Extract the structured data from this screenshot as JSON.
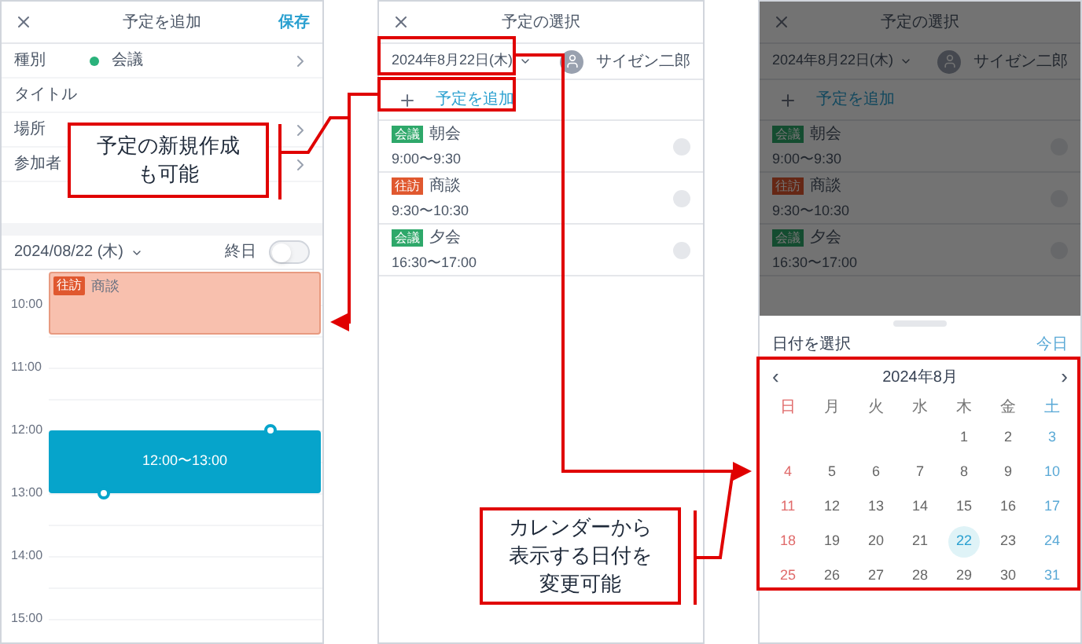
{
  "left_screen": {
    "title": "予定を追加",
    "save": "保存",
    "fields": [
      {
        "label": "種別",
        "value": "会議",
        "color": "#2ab27b",
        "chevron": true
      },
      {
        "label": "タイトル",
        "chevron": false
      },
      {
        "label": "場所",
        "chevron": true
      },
      {
        "label": "参加者",
        "chevron": true
      }
    ],
    "date": "2024/08/22 (木)",
    "all_day": {
      "label": "終日",
      "on": false
    },
    "hours": [
      "10:00",
      "11:00",
      "12:00",
      "13:00",
      "14:00",
      "15:00"
    ],
    "events": [
      {
        "kind": "visit",
        "tag": "往訪",
        "title": "商談"
      },
      {
        "kind": "draft",
        "time": "12:00〜13:00"
      }
    ]
  },
  "middle_screen": {
    "title": "予定の選択",
    "date": "2024年8月22日(木)",
    "user": "サイゼン二郎",
    "add": "予定を追加",
    "items": [
      {
        "kind": "meeting",
        "tag": "会議",
        "title": "朝会",
        "time": "9:00〜9:30",
        "selected": false
      },
      {
        "kind": "visit",
        "tag": "往訪",
        "title": "商談",
        "time": "9:30〜10:30",
        "selected": false
      },
      {
        "kind": "meeting",
        "tag": "会議",
        "title": "夕会",
        "time": "16:30〜17:00",
        "selected": false
      }
    ]
  },
  "right_screen": {
    "title": "予定の選択",
    "date": "2024年8月22日(木)",
    "user": "サイゼン二郎",
    "add": "予定を追加",
    "items": [
      {
        "kind": "meeting",
        "tag": "会議",
        "title": "朝会",
        "time": "9:00〜9:30",
        "selected": false
      },
      {
        "kind": "visit",
        "tag": "往訪",
        "title": "商談",
        "time": "9:30〜10:30",
        "selected": false
      },
      {
        "kind": "meeting",
        "tag": "会議",
        "title": "夕会",
        "time": "16:30〜17:00",
        "selected": false
      }
    ],
    "picker": {
      "title": "日付を選択",
      "today": "今日",
      "month": "2024年8月",
      "prev": "‹",
      "next": "›",
      "weekdays": [
        {
          "label": "日",
          "color": "#e06a6a"
        },
        {
          "label": "月",
          "color": "#777777"
        },
        {
          "label": "火",
          "color": "#777777"
        },
        {
          "label": "水",
          "color": "#777777"
        },
        {
          "label": "木",
          "color": "#777777"
        },
        {
          "label": "金",
          "color": "#777777"
        },
        {
          "label": "土",
          "color": "#5aa9d6"
        }
      ],
      "weeks": [
        [
          {
            "day": "1",
            "selected": false
          },
          {
            "day": "2",
            "selected": false
          },
          {
            "day": "3",
            "selected": false
          }
        ],
        [
          {
            "day": "4",
            "selected": false
          },
          {
            "day": "5",
            "selected": false
          },
          {
            "day": "6",
            "selected": false
          },
          {
            "day": "7",
            "selected": false
          },
          {
            "day": "8",
            "selected": false
          },
          {
            "day": "9",
            "selected": false
          },
          {
            "day": "10",
            "selected": false
          }
        ],
        [
          {
            "day": "11",
            "selected": false
          },
          {
            "day": "12",
            "selected": false
          },
          {
            "day": "13",
            "selected": false
          },
          {
            "day": "14",
            "selected": false
          },
          {
            "day": "15",
            "selected": false
          },
          {
            "day": "16",
            "selected": false
          },
          {
            "day": "17",
            "selected": false
          }
        ],
        [
          {
            "day": "18",
            "selected": false
          },
          {
            "day": "19",
            "selected": false
          },
          {
            "day": "20",
            "selected": false
          },
          {
            "day": "21",
            "selected": false
          },
          {
            "day": "22",
            "selected": true
          },
          {
            "day": "23",
            "selected": false
          },
          {
            "day": "24",
            "selected": false
          }
        ],
        [
          {
            "day": "25",
            "selected": false
          },
          {
            "day": "26",
            "selected": false
          },
          {
            "day": "27",
            "selected": false
          },
          {
            "day": "28",
            "selected": false
          },
          {
            "day": "29",
            "selected": false
          },
          {
            "day": "30",
            "selected": false
          },
          {
            "day": "31",
            "selected": false
          }
        ]
      ]
    }
  },
  "callouts": [
    {
      "lines": [
        "予定の新規作成",
        "も可能"
      ]
    },
    {
      "lines": [
        "カレンダーから",
        "表示する日付を",
        "変更可能"
      ]
    }
  ]
}
